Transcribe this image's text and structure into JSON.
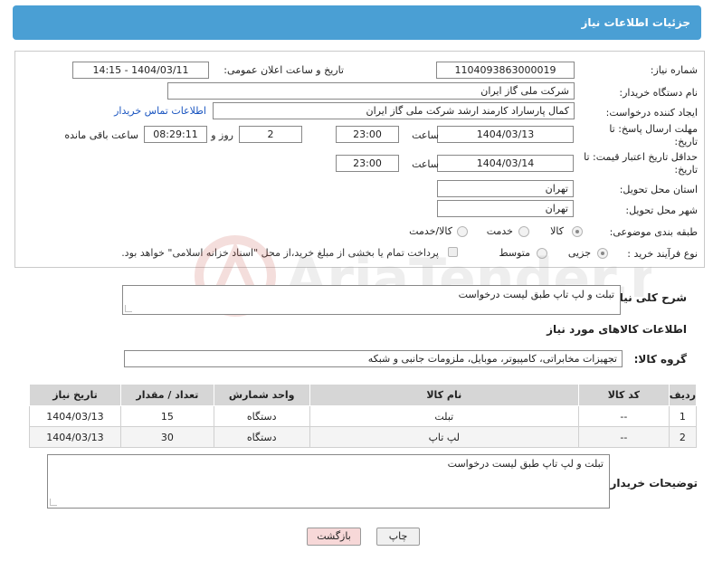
{
  "header": {
    "title": "جزئیات اطلاعات نیاز"
  },
  "form": {
    "need_number_label": "شماره نیاز:",
    "need_number": "1104093863000019",
    "announce_label": "تاریخ و ساعت اعلان عمومی:",
    "announce_value": "1404/03/11 - 14:15",
    "buyer_org_label": "نام دستگاه خریدار:",
    "buyer_org": "شرکت ملی گاز ایران",
    "creator_label": "ایجاد کننده درخواست:",
    "creator": "کمال پارساراد کارمند ارشد شرکت ملی گاز ایران",
    "contact_link": "اطلاعات تماس خریدار",
    "reply_deadline_label": "مهلت ارسال پاسخ: تا تاریخ:",
    "reply_date": "1404/03/13",
    "time_word": "ساعت",
    "reply_time": "23:00",
    "days_value": "2",
    "days_word": "روز و",
    "remaining_time": "08:29:11",
    "remaining_label": "ساعت باقی مانده",
    "price_deadline_label": "حداقل تاریخ اعتبار قیمت: تا تاریخ:",
    "price_date": "1404/03/14",
    "price_time": "23:00",
    "province_label": "استان محل تحویل:",
    "province": "تهران",
    "city_label": "شهر محل تحویل:",
    "city": "تهران",
    "category_label": "طبقه بندی موضوعی:",
    "category_options": [
      "کالا",
      "خدمت",
      "کالا/خدمت"
    ],
    "process_label": "نوع فرآیند خرید :",
    "process_options": [
      "جزیی",
      "متوسط"
    ],
    "payment_note": "پرداخت تمام یا بخشی از مبلغ خرید،از محل \"اسناد خزانه اسلامی\" خواهد بود."
  },
  "summary": {
    "label": "شرح کلی نیاز:",
    "text": "تبلت و لپ تاپ طبق لیست درخواست"
  },
  "goods": {
    "section_title": "اطلاعات کالاهای مورد نیاز",
    "group_label": "گروه کالا:",
    "group_value": "تجهیزات مخابراتی، کامپیوتر، موبایل، ملزومات جانبی و شبکه",
    "columns": [
      "ردیف",
      "کد کالا",
      "نام کالا",
      "واحد شمارش",
      "تعداد / مقدار",
      "تاریخ نیاز"
    ],
    "rows": [
      [
        "1",
        "--",
        "تبلت",
        "دستگاه",
        "15",
        "1404/03/13"
      ],
      [
        "2",
        "--",
        "لپ تاپ",
        "دستگاه",
        "30",
        "1404/03/13"
      ]
    ]
  },
  "buyer_notes": {
    "label": "توضیحات خریدار:",
    "text": "تبلت و لپ تاپ طبق لیست درخواست"
  },
  "buttons": {
    "print": "چاپ",
    "back": "بازگشت"
  },
  "watermark": "AriaTender.neT",
  "colors": {
    "header": "#4a9fd4",
    "back_button": "#f7d8d8",
    "print_button": "#f0f0f0"
  }
}
